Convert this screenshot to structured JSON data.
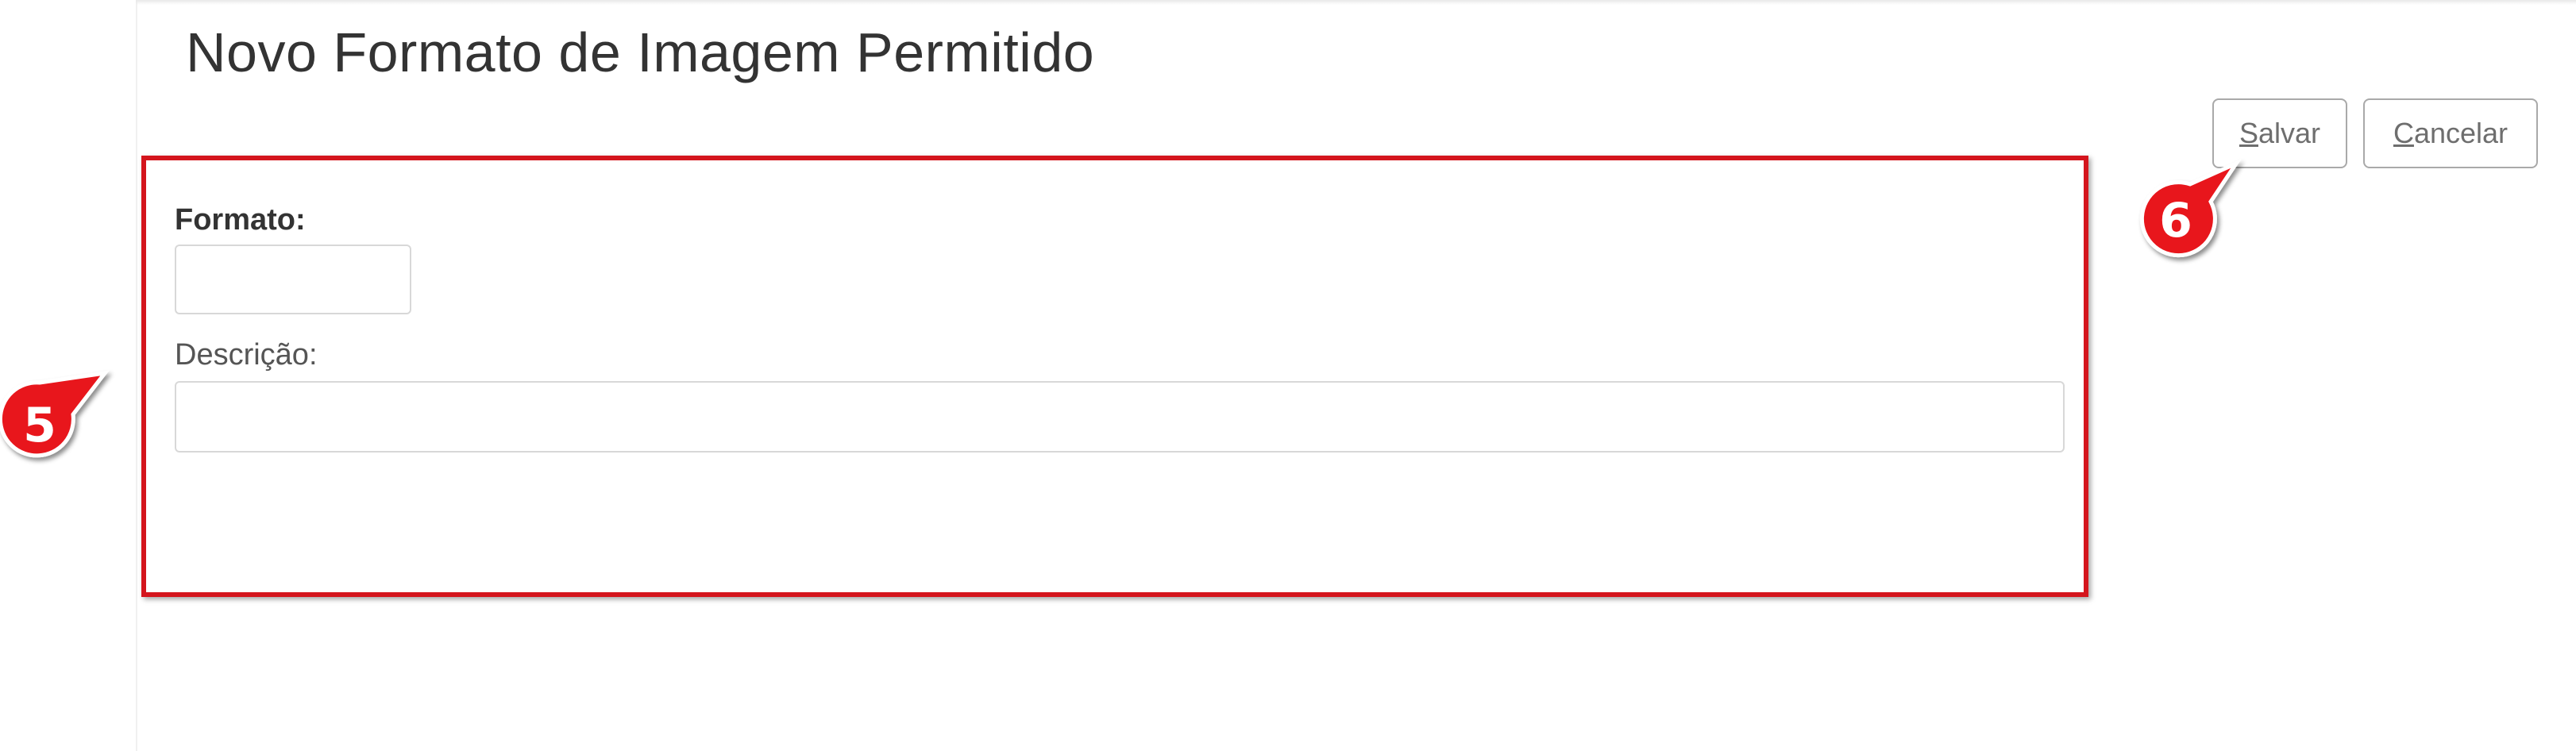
{
  "page": {
    "title": "Novo Formato de Imagem Permitido"
  },
  "toolbar": {
    "save_access_key": "S",
    "save_rest": "alvar",
    "cancel_access_key": "C",
    "cancel_rest": "ancelar"
  },
  "form": {
    "format_label": "Formato:",
    "format_value": "",
    "description_label": "Descrição:",
    "description_value": ""
  },
  "annotations": {
    "callout_form": "5",
    "callout_save": "6",
    "highlight_color": "#d4151d"
  }
}
